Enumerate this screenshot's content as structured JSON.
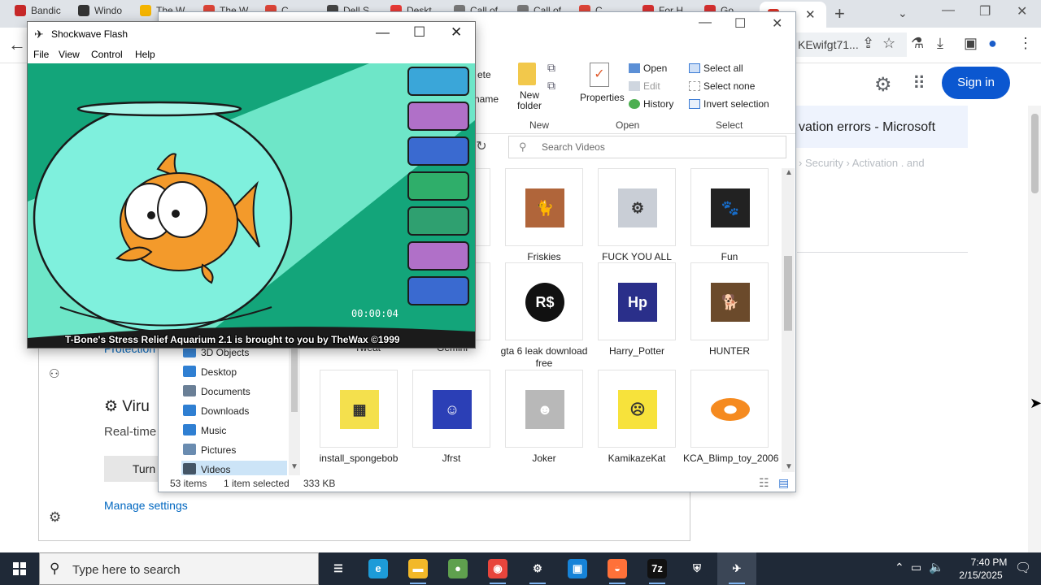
{
  "browser": {
    "tabs": [
      {
        "label": "Bandic",
        "color": "#c62828"
      },
      {
        "label": "Windo",
        "color": "#333333"
      },
      {
        "label": "The W",
        "color": "#f4b400"
      },
      {
        "label": "The W",
        "color": "#db4437"
      },
      {
        "label": "C",
        "color": "#db4437"
      },
      {
        "label": "Dell S",
        "color": "#444444"
      },
      {
        "label": "Deskt",
        "color": "#e53935"
      },
      {
        "label": "Call of",
        "color": "#777777"
      },
      {
        "label": "Call of",
        "color": "#777777"
      },
      {
        "label": "C",
        "color": "#db4437"
      },
      {
        "label": "For H",
        "color": "#d32f2f"
      },
      {
        "label": "Go",
        "color": "#d32f2f"
      }
    ],
    "new_tab": "+",
    "url": "KEwifgt71...",
    "sign_in": "Sign in",
    "result_title": "vation errors - Microsoft",
    "result_breadcrumb": "› Security › Activation . and"
  },
  "winsec": {
    "protection_link": "Protection",
    "virus_heading": "⚙ Viru",
    "realtime_text": "Real-time",
    "turn_btn": "Turn",
    "manage_settings": "Manage settings"
  },
  "explorer": {
    "ribbon": {
      "partial_delete": "ete",
      "partial_rename": "name",
      "new_folder": "New folder",
      "new_group": "New",
      "properties": "Properties",
      "open": "Open",
      "edit": "Edit",
      "history": "History",
      "open_group": "Open",
      "select_all": "Select all",
      "select_none": "Select none",
      "invert_selection": "Invert selection",
      "select_group": "Select"
    },
    "search_placeholder": "Search Videos",
    "nav": [
      {
        "label": "3D Objects",
        "color": "#3a87d8"
      },
      {
        "label": "Desktop",
        "color": "#2f7fd2"
      },
      {
        "label": "Documents",
        "color": "#6a7f96"
      },
      {
        "label": "Downloads",
        "color": "#2f7fd2"
      },
      {
        "label": "Music",
        "color": "#2f7fd2"
      },
      {
        "label": "Pictures",
        "color": "#6a8cb0"
      },
      {
        "label": "Videos",
        "color": "#445566"
      }
    ],
    "partial_labels": {
      "a": "Tweat",
      "b": "Gemini"
    },
    "files": [
      {
        "name": "Friskies",
        "icon": "cat-icon"
      },
      {
        "name": "FUCK YOU ALL",
        "icon": "settings-file-icon"
      },
      {
        "name": "Fun",
        "icon": "paw-prints-icon"
      },
      {
        "name": "gta 6 leak download free",
        "icon": "robux-icon"
      },
      {
        "name": "Harry_Potter",
        "icon": "hp-logo-icon"
      },
      {
        "name": "HUNTER",
        "icon": "dog-icon"
      },
      {
        "name": "install_spongebob",
        "icon": "spongebob-icon"
      },
      {
        "name": "Jfrst",
        "icon": "jester-icon"
      },
      {
        "name": "Joker",
        "icon": "joker-icon"
      },
      {
        "name": "KamikazeKat",
        "icon": "kamikaze-cat-icon"
      },
      {
        "name": "KCA_Blimp_toy_2006",
        "icon": "blimp-icon"
      }
    ],
    "status": {
      "count": "53 items",
      "selected": "1 item selected",
      "size": "333 KB"
    }
  },
  "flash": {
    "title": "Shockwave Flash",
    "menu": [
      "File",
      "View",
      "Control",
      "Help"
    ],
    "timer": "00:00:04",
    "credits": "T-Bone's Stress Relief Aquarium 2.1 is brought to you by TheWax ©1999",
    "tools": [
      {
        "name": "electric-plug-tool",
        "color": "#3aa6d9"
      },
      {
        "name": "frying-pan-tool",
        "color": "#b070c8"
      },
      {
        "name": "shark-jaws-tool",
        "color": "#3a6ad0"
      },
      {
        "name": "food-can-tool",
        "color": "#2fae6a"
      },
      {
        "name": "cat-tool",
        "color": "#2fa070"
      },
      {
        "name": "toilet-tool",
        "color": "#b070c8"
      },
      {
        "name": "bomb-tool",
        "color": "#3a6ad0"
      }
    ],
    "colors": {
      "stage": "#13a57a",
      "light": "#6ee6c8",
      "bowl": "#7ff0dd",
      "fish": "#f39a2b"
    }
  },
  "taskbar": {
    "search_placeholder": "Type here to search",
    "apps": [
      {
        "name": "task-view",
        "glyph": "☰",
        "color": "#1f2937"
      },
      {
        "name": "edge",
        "glyph": "e",
        "color": "#1d9bd8"
      },
      {
        "name": "file-explorer",
        "glyph": "▬",
        "color": "#f2b829"
      },
      {
        "name": "globe-app",
        "glyph": "●",
        "color": "#5fa04e"
      },
      {
        "name": "chrome",
        "glyph": "◉",
        "color": "#e8453c"
      },
      {
        "name": "settings",
        "glyph": "⚙",
        "color": "#1f2937"
      },
      {
        "name": "sandbox",
        "glyph": "▣",
        "color": "#1683d8"
      },
      {
        "name": "firefox",
        "glyph": "◒",
        "color": "#ff7139"
      },
      {
        "name": "7zip",
        "glyph": "7z",
        "color": "#111111"
      },
      {
        "name": "security",
        "glyph": "⛨",
        "color": "#1f2937"
      },
      {
        "name": "flash-player",
        "glyph": "✈",
        "color": "#3b4656"
      }
    ],
    "time": "7:40 PM",
    "date": "2/15/2025"
  }
}
